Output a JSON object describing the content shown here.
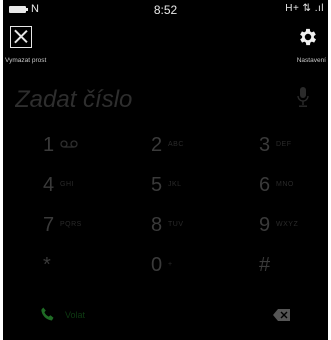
{
  "status_bar": {
    "time": "8:52",
    "carrier_glyph": "N",
    "network": "H+ ⇅ .ıl"
  },
  "toolbar": {
    "clear_label": "Vymazat prost",
    "settings_label": "Nastavení"
  },
  "display": {
    "placeholder": "Zadat číslo"
  },
  "keypad": {
    "keys": [
      {
        "digit": "1",
        "letters": ""
      },
      {
        "digit": "2",
        "letters": "ABC"
      },
      {
        "digit": "3",
        "letters": "DEF"
      },
      {
        "digit": "4",
        "letters": "GHI"
      },
      {
        "digit": "5",
        "letters": "JKL"
      },
      {
        "digit": "6",
        "letters": "MNO"
      },
      {
        "digit": "7",
        "letters": "PQRS"
      },
      {
        "digit": "8",
        "letters": "TUV"
      },
      {
        "digit": "9",
        "letters": "WXYZ"
      },
      {
        "digit": "*",
        "letters": ""
      },
      {
        "digit": "0",
        "letters": "+"
      },
      {
        "digit": "#",
        "letters": ""
      }
    ]
  },
  "bottom": {
    "call_label": "Volat"
  },
  "colors": {
    "background": "#000000",
    "call_green": "#1f6b25",
    "key_text": "#3a3a3a"
  }
}
